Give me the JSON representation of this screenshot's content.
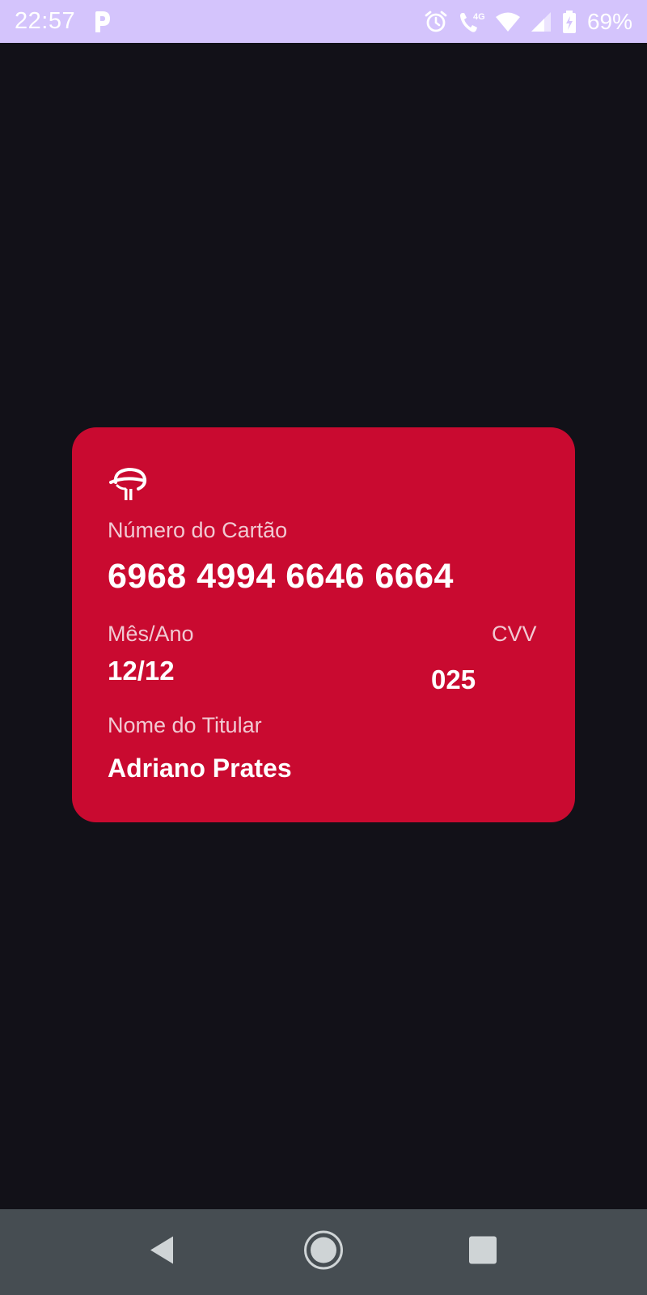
{
  "status_bar": {
    "time": "22:57",
    "battery_percent": "69%",
    "network_type": "4G",
    "icons": [
      "parking-app-icon",
      "alarm-icon",
      "wifi-calling-icon",
      "wifi-icon",
      "cell-signal-icon",
      "battery-charging-icon"
    ],
    "background_color": "#d4c4fc"
  },
  "card": {
    "background_color": "#c90a30",
    "logo_icon": "bank-logo-icon",
    "number_label": "Número do Cartão",
    "number": "6968 4994 6646 6664",
    "expiry_label": "Mês/Ano",
    "expiry": "12/12",
    "cvv_label": "CVV",
    "cvv": "025",
    "holder_label": "Nome do Titular",
    "holder": "Adriano Prates"
  },
  "nav_bar": {
    "icons": [
      "back-icon",
      "home-icon",
      "recents-icon"
    ],
    "background_color": "#464d52"
  },
  "app": {
    "background_color": "#121118"
  }
}
